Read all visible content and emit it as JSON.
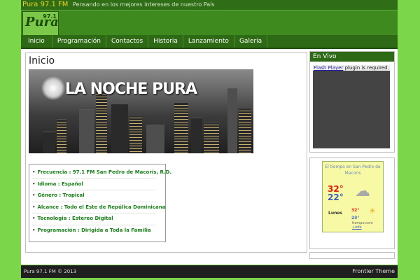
{
  "topbar": {
    "site_title": "Pura 97.1 FM",
    "tagline": "Pensando en los mejores intereses de nuestro País"
  },
  "logo": {
    "text": "Pura",
    "number": "97.1"
  },
  "nav": [
    "Inicio",
    "Programación",
    "Contactos",
    "Historia",
    "Lanzamiento",
    "Galeria"
  ],
  "main": {
    "heading": "Inicio",
    "banner_text": "LA NOCHE PURA",
    "info": [
      "Frecuencia : 97.1 FM San Pedro de Macorís, R.D.",
      "Idioma : Español",
      "Género : Tropical",
      "Alcance : Todo el Este de Repúlica Dominicana",
      "Tecnologia : Estereo Digital",
      "Programación : Dirigida a Toda la Familia"
    ]
  },
  "sidebar": {
    "live_title": "En Vivo",
    "player_link": "Flash Player",
    "player_msg": "plugin is required.",
    "weather": {
      "title": "El tiempo en San Pedro de Macoris",
      "temp_now_hi": "32°",
      "temp_now_lo": "22°",
      "day": "Lunes",
      "day_hi": "32°",
      "day_lo": "23°",
      "brand": "tiempo.com",
      "brand_link": "+info"
    }
  },
  "footer": {
    "copyright": "Pura 97.1 FM © 2013",
    "theme": "Frontier Theme"
  }
}
